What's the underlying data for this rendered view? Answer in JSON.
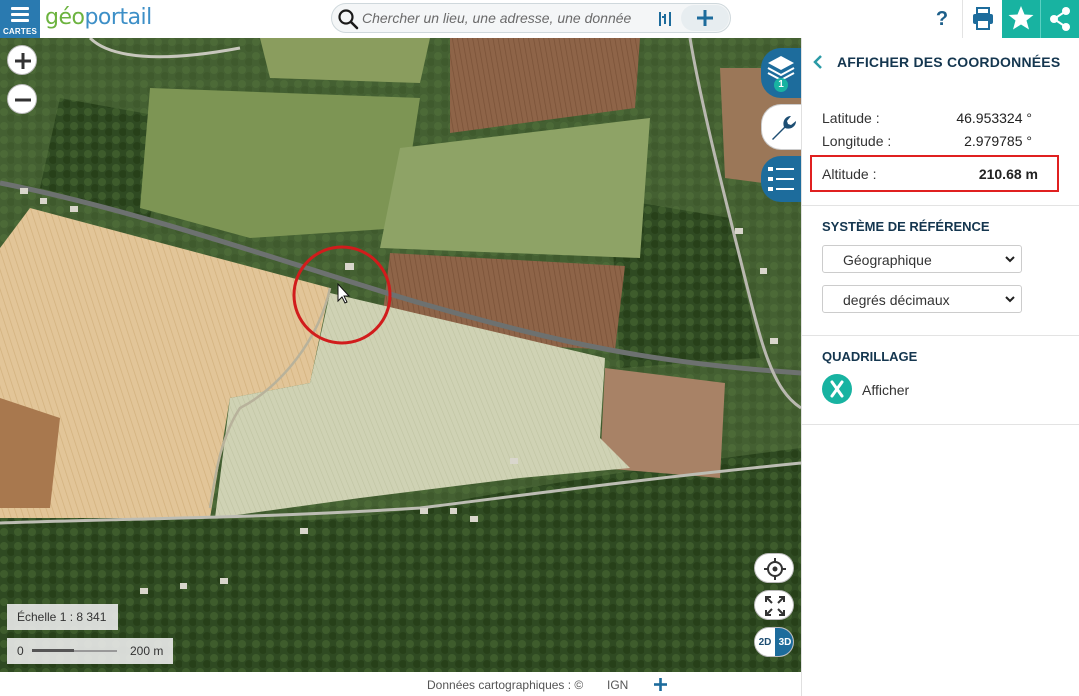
{
  "app": {
    "menu_label": "CARTES",
    "logo_geo": "géo",
    "logo_portail": "portail"
  },
  "search": {
    "placeholder": "Chercher un lieu, une adresse, une donnée"
  },
  "toolbar": {
    "help": "?"
  },
  "map": {
    "scale_label": "Échelle 1 : 8 341",
    "scalebar_min": "0",
    "scalebar_max": "200 m",
    "dim_2d": "2D",
    "dim_3d": "3D",
    "layer_count": "1"
  },
  "footer": {
    "credits": "Données cartographiques : ©",
    "provider": "IGN"
  },
  "panel": {
    "title": "AFFICHER DES COORDONNÉES",
    "latitude_label": "Latitude :",
    "latitude_value": "46.953324 °",
    "longitude_label": "Longitude :",
    "longitude_value": "2.979785 °",
    "altitude_label": "Altitude :",
    "altitude_value": "210.68 m",
    "ref_title": "SYSTÈME DE RÉFÉRENCE",
    "ref_system": "Géographique",
    "ref_units": "degrés décimaux",
    "grid_title": "QUADRILLAGE",
    "grid_label": "Afficher"
  },
  "colors": {
    "brand_blue": "#1d6c9c",
    "accent_teal": "#18b3a1",
    "highlight_red": "#e02020"
  }
}
